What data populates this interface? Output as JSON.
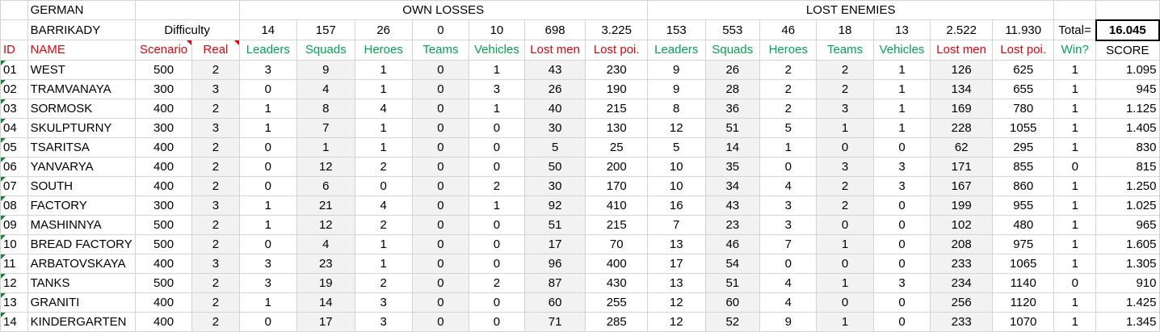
{
  "header": {
    "faction": "GERMAN",
    "campaign": "BARRIKADY",
    "difficulty_label": "Difficulty",
    "own_losses_label": "OWN LOSSES",
    "lost_enemies_label": "LOST ENEMIES",
    "total_label": "Total=",
    "total_value": "16.045"
  },
  "totals": {
    "own": [
      "14",
      "157",
      "26",
      "0",
      "10",
      "698",
      "3.225"
    ],
    "enemy": [
      "153",
      "553",
      "46",
      "18",
      "13",
      "2.522",
      "11.930"
    ]
  },
  "columns": {
    "id": "ID",
    "name": "NAME",
    "scenario": "Scenario",
    "real": "Real",
    "own": [
      "Leaders",
      "Squads",
      "Heroes",
      "Teams",
      "Vehicles",
      "Lost men",
      "Lost poi."
    ],
    "enemy": [
      "Leaders",
      "Squads",
      "Heroes",
      "Teams",
      "Vehicles",
      "Lost men",
      "Lost poi."
    ],
    "win": "Win?",
    "score": "SCORE"
  },
  "rows": [
    [
      "01",
      "WEST",
      "500",
      "2",
      "3",
      "9",
      "1",
      "0",
      "1",
      "43",
      "230",
      "9",
      "26",
      "2",
      "2",
      "1",
      "126",
      "625",
      "1",
      "1.095"
    ],
    [
      "02",
      "TRAMVANAYA",
      "300",
      "3",
      "0",
      "4",
      "1",
      "0",
      "3",
      "26",
      "190",
      "9",
      "28",
      "2",
      "2",
      "1",
      "134",
      "655",
      "1",
      "945"
    ],
    [
      "03",
      "SORMOSK",
      "400",
      "2",
      "1",
      "8",
      "4",
      "0",
      "1",
      "40",
      "215",
      "8",
      "36",
      "2",
      "3",
      "1",
      "169",
      "780",
      "1",
      "1.125"
    ],
    [
      "04",
      "SKULPTURNY",
      "300",
      "3",
      "1",
      "7",
      "1",
      "0",
      "0",
      "30",
      "130",
      "12",
      "51",
      "5",
      "1",
      "1",
      "228",
      "1055",
      "1",
      "1.405"
    ],
    [
      "05",
      "TSARITSA",
      "400",
      "2",
      "0",
      "1",
      "1",
      "0",
      "0",
      "5",
      "25",
      "5",
      "14",
      "1",
      "0",
      "0",
      "62",
      "295",
      "1",
      "830"
    ],
    [
      "06",
      "YANVARYA",
      "400",
      "2",
      "0",
      "12",
      "2",
      "0",
      "0",
      "50",
      "200",
      "10",
      "35",
      "0",
      "3",
      "3",
      "171",
      "855",
      "0",
      "815"
    ],
    [
      "07",
      "SOUTH",
      "400",
      "2",
      "0",
      "6",
      "0",
      "0",
      "2",
      "30",
      "170",
      "10",
      "34",
      "4",
      "2",
      "3",
      "167",
      "860",
      "1",
      "1.250"
    ],
    [
      "08",
      "FACTORY",
      "300",
      "3",
      "1",
      "21",
      "4",
      "0",
      "1",
      "92",
      "410",
      "16",
      "43",
      "3",
      "2",
      "0",
      "199",
      "955",
      "1",
      "1.025"
    ],
    [
      "09",
      "MASHINNYA",
      "500",
      "2",
      "1",
      "12",
      "2",
      "0",
      "0",
      "51",
      "215",
      "7",
      "23",
      "3",
      "0",
      "0",
      "102",
      "480",
      "1",
      "965"
    ],
    [
      "10",
      "BREAD FACTORY",
      "500",
      "2",
      "0",
      "4",
      "1",
      "0",
      "0",
      "17",
      "70",
      "13",
      "46",
      "7",
      "1",
      "0",
      "208",
      "975",
      "1",
      "1.605"
    ],
    [
      "11",
      "ARBATOVSKAYA",
      "400",
      "3",
      "3",
      "23",
      "1",
      "0",
      "0",
      "96",
      "400",
      "17",
      "54",
      "0",
      "0",
      "0",
      "233",
      "1065",
      "1",
      "1.305"
    ],
    [
      "12",
      "TANKS",
      "500",
      "2",
      "3",
      "19",
      "2",
      "0",
      "2",
      "87",
      "430",
      "13",
      "51",
      "4",
      "1",
      "3",
      "234",
      "1140",
      "0",
      "910"
    ],
    [
      "13",
      "GRANITI",
      "400",
      "2",
      "1",
      "14",
      "3",
      "0",
      "0",
      "60",
      "255",
      "12",
      "60",
      "4",
      "0",
      "0",
      "256",
      "1120",
      "1",
      "1.425"
    ],
    [
      "14",
      "KINDERGARTEN",
      "400",
      "2",
      "0",
      "17",
      "3",
      "0",
      "0",
      "71",
      "285",
      "12",
      "52",
      "9",
      "1",
      "0",
      "233",
      "1070",
      "1",
      "1.345"
    ]
  ]
}
